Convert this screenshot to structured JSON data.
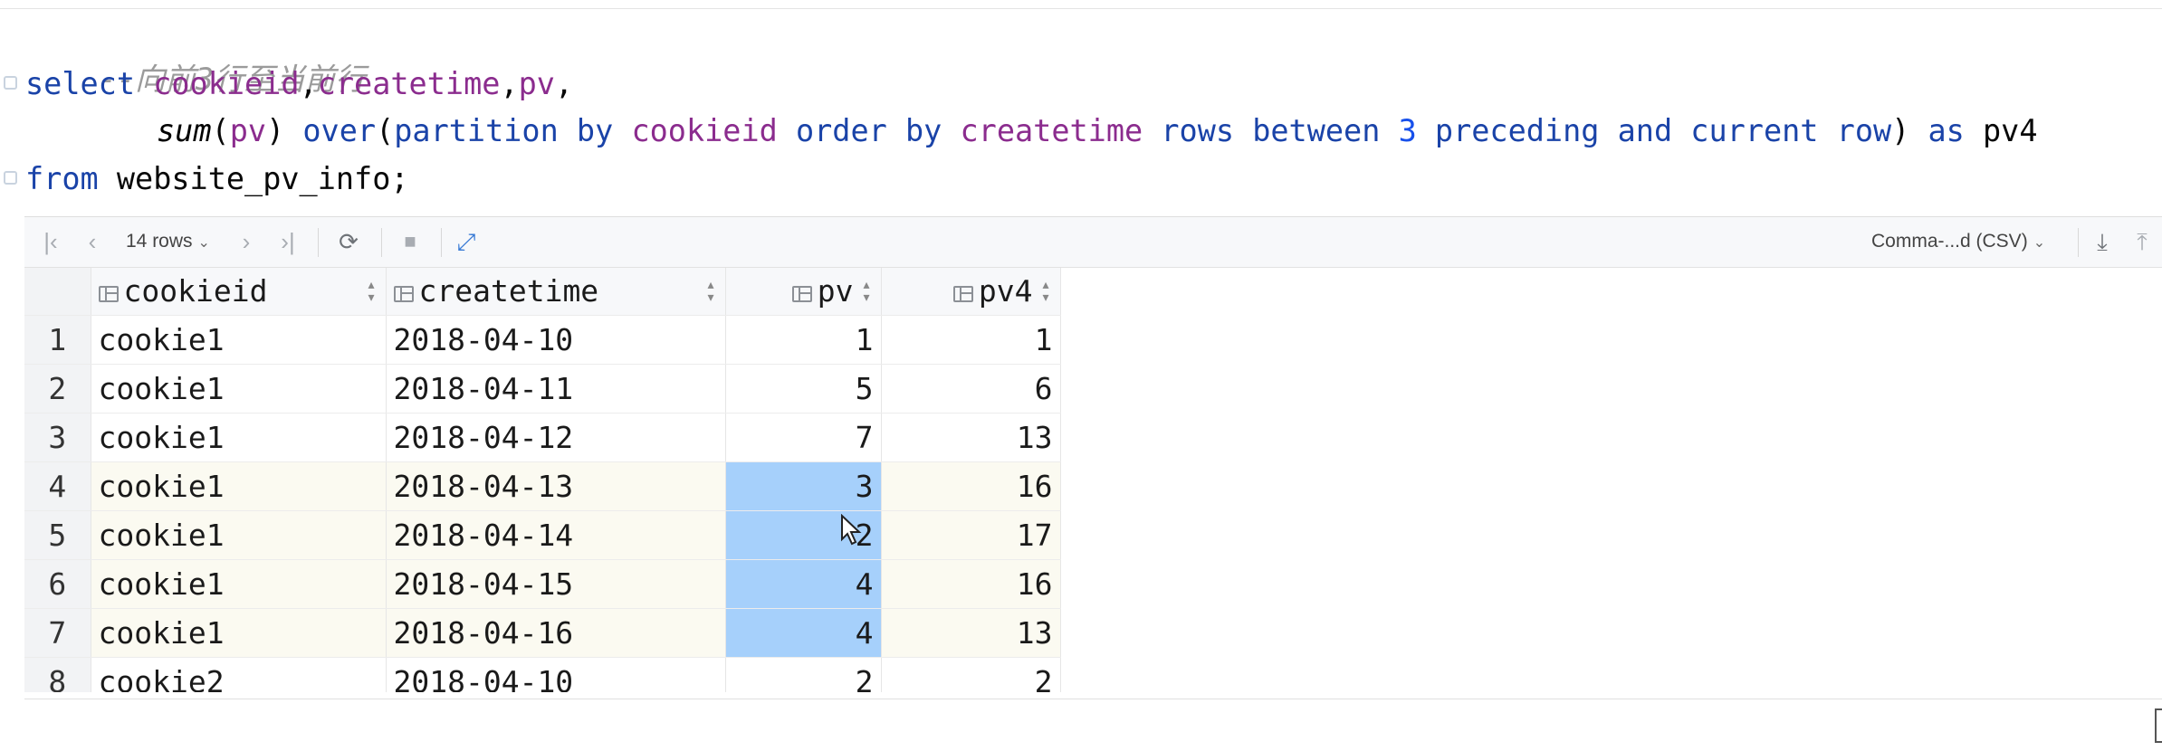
{
  "editor": {
    "comment": "--向前3行至当前行",
    "line1": {
      "kw_select": "select",
      "f1": "cookieid",
      "c1": ",",
      "f2": "createtime",
      "c2": ",",
      "f3": "pv",
      "c3": ","
    },
    "line2": {
      "fn": "sum",
      "p1": "(",
      "arg": "pv",
      "p2": ") ",
      "kw_over": "over",
      "p3": "(",
      "kw_partition": "partition by",
      "part_field": "cookieid",
      "kw_order": "order by",
      "order_field": "createtime",
      "kw_rows": "rows between",
      "num": "3",
      "kw_preceding": "preceding",
      "kw_and": "and",
      "kw_current": "current row",
      "p4": ") ",
      "kw_as": "as",
      "alias": "pv4"
    },
    "line3": {
      "kw_from": "from",
      "table": "website_pv_info;"
    }
  },
  "toolbar": {
    "rows_label": "14 rows",
    "export_format": "Comma-...d (CSV)"
  },
  "grid": {
    "columns": [
      "cookieid",
      "createtime",
      "pv",
      "pv4"
    ],
    "rows": [
      {
        "n": "1",
        "cookieid": "cookie1",
        "createtime": "2018-04-10",
        "pv": "1",
        "pv4": "1"
      },
      {
        "n": "2",
        "cookieid": "cookie1",
        "createtime": "2018-04-11",
        "pv": "5",
        "pv4": "6"
      },
      {
        "n": "3",
        "cookieid": "cookie1",
        "createtime": "2018-04-12",
        "pv": "7",
        "pv4": "13"
      },
      {
        "n": "4",
        "cookieid": "cookie1",
        "createtime": "2018-04-13",
        "pv": "3",
        "pv4": "16"
      },
      {
        "n": "5",
        "cookieid": "cookie1",
        "createtime": "2018-04-14",
        "pv": "2",
        "pv4": "17"
      },
      {
        "n": "6",
        "cookieid": "cookie1",
        "createtime": "2018-04-15",
        "pv": "4",
        "pv4": "16"
      },
      {
        "n": "7",
        "cookieid": "cookie1",
        "createtime": "2018-04-16",
        "pv": "4",
        "pv4": "13"
      },
      {
        "n": "8",
        "cookieid": "cookie2",
        "createtime": "2018-04-10",
        "pv": "2",
        "pv4": "2"
      }
    ]
  },
  "icons": {
    "first": "first-page-icon",
    "prev": "prev-page-icon",
    "next": "next-page-icon",
    "last": "last-page-icon",
    "refresh": "refresh-icon",
    "stop": "stop-icon",
    "compare": "compare-icon",
    "download": "download-icon",
    "upload": "upload-icon"
  },
  "colors": {
    "keyword": "#1a43a8",
    "field": "#8b2c8e",
    "selection": "#a6d0fb",
    "comment": "#9b9b9b"
  }
}
